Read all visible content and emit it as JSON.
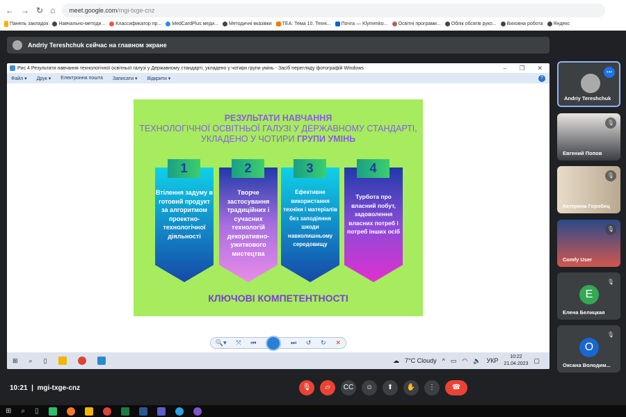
{
  "browser": {
    "url_host": "meet.google.com",
    "url_path": "/mgi-txge-cnz",
    "bookmarks": [
      "Панель закладок",
      "Навчально-методи...",
      "Классификатор пр...",
      "MedCardPlus меди...",
      "Методичні вказівки",
      "TEA: Тема 10. Техні...",
      "Почта — Klymenko...",
      "Освітні програми...",
      "Облік обсягів руко...",
      "Виховна робота",
      "Яндекс"
    ]
  },
  "banner": {
    "text": "Andriy Tereshchuk сейчас на главном экране"
  },
  "window": {
    "title": "Рис 4  Результати навчання технологічної освітньої галузі у Державному стандарті, укладено у чотири групи умінь - Засіб перегляду фотографій Windows",
    "menu": [
      "Файл ▾",
      "Друк ▾",
      "Електронна пошта",
      "Записати ▾",
      "Відкрити ▾"
    ]
  },
  "slide": {
    "title1": "РЕЗУЛЬТАТИ НАВЧАННЯ",
    "title2": "ТЕХНОЛОГІЧНОЇ ОСВІТНЬОЇ ГАЛУЗІ У ДЕРЖАВНОМУ СТАНДАРТІ,",
    "title3a": "УКЛАДЕНО У ЧОТИРИ ",
    "title3b": "ГРУПИ УМІНЬ",
    "cards": [
      {
        "num": "1",
        "text": "Втілення задуму в готовий продукт за алгоритмом проектно-технологічної діяльності"
      },
      {
        "num": "2",
        "text": "Творче застосування традиційних і сучасних технологій декоративно-ужиткового мистецтва"
      },
      {
        "num": "3",
        "text": "Ефективне використання техніки і матеріалів без заподіяння шкоди навколишньому середовищу"
      },
      {
        "num": "4",
        "text": "Турбота про власний побут, задоволення власних потреб і потреб інших осіб"
      }
    ],
    "footer": "КЛЮЧОВІ КОМПЕТЕНТНОСТІ"
  },
  "remote_taskbar": {
    "weather": "7°C  Cloudy",
    "lang": "УКР",
    "time": "10:22",
    "date": "21.04.2023"
  },
  "participants": [
    {
      "name": "Andriy Tereshchuk"
    },
    {
      "name": "Евгений Попов"
    },
    {
      "name": "Катерина Горобец"
    },
    {
      "name": "Comfy User"
    },
    {
      "name": "Елена Белицкая",
      "letter": "E",
      "color": "#34a853"
    },
    {
      "name": "Оксана Володим...",
      "letter": "O",
      "color": "#1967d2"
    }
  ],
  "meeting": {
    "time": "10:21",
    "code": "mgi-txge-cnz"
  }
}
